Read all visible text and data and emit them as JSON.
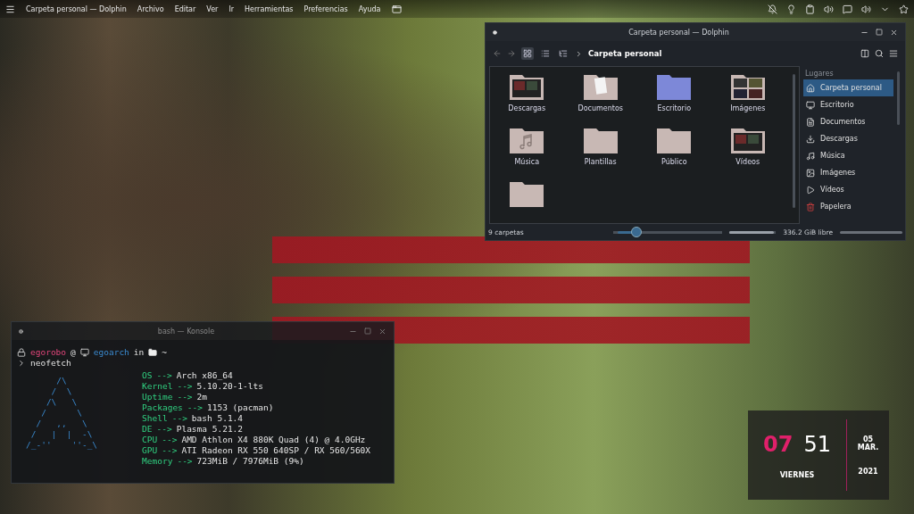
{
  "top_panel": {
    "window_title": "Carpeta personal — Dolphin",
    "menus": [
      "Archivo",
      "Editar",
      "Ver",
      "Ir",
      "Herramientas",
      "Preferencias",
      "Ayuda"
    ]
  },
  "dolphin": {
    "title": "Carpeta personal — Dolphin",
    "view_modes": [
      {
        "kind": "icons",
        "selected": true
      },
      {
        "kind": "compact",
        "selected": false
      },
      {
        "kind": "details",
        "selected": false
      }
    ],
    "breadcrumb": "Carpeta personal",
    "files": [
      {
        "name": "Descargas",
        "kind": "media"
      },
      {
        "name": "Documentos",
        "kind": "document"
      },
      {
        "name": "Escritorio",
        "kind": "desktop"
      },
      {
        "name": "Imágenes",
        "kind": "images"
      },
      {
        "name": "Música",
        "kind": "music"
      },
      {
        "name": "Plantillas",
        "kind": "plain"
      },
      {
        "name": "Público",
        "kind": "plain"
      },
      {
        "name": "Vídeos",
        "kind": "media"
      },
      {
        "kind": "plain"
      }
    ],
    "places_title": "Lugares",
    "places": [
      {
        "label": "Carpeta personal",
        "kind": "home",
        "selected": true
      },
      {
        "label": "Escritorio",
        "kind": "desktop",
        "selected": false
      },
      {
        "label": "Documentos",
        "kind": "document",
        "selected": false
      },
      {
        "label": "Descargas",
        "kind": "download",
        "selected": false
      },
      {
        "label": "Música",
        "kind": "music",
        "selected": false
      },
      {
        "label": "Imágenes",
        "kind": "image",
        "selected": false
      },
      {
        "label": "Vídeos",
        "kind": "video",
        "selected": false
      },
      {
        "label": "Papelera",
        "kind": "trash",
        "selected": false
      }
    ],
    "status": "9 carpetas",
    "zoom": {
      "level": 0.2
    },
    "free_space": {
      "text": "336.2 GiB libre",
      "level": 0.95
    }
  },
  "konsole": {
    "title": "bash — Konsole",
    "user": "egorobo",
    "at": "@",
    "host": "egoarch",
    "in": "in",
    "path": "~",
    "command": "neofetch",
    "logo_lines": [
      "      /\\",
      "     /  \\",
      "    /\\   \\",
      "   /      \\",
      "  /   ,,   \\",
      " /   |  |  -\\",
      "/_-''    ''-_\\"
    ],
    "info": [
      {
        "key": "OS",
        "arrow": "-->",
        "value": "Arch x86_64"
      },
      {
        "key": "Kernel",
        "arrow": "-->",
        "value": "5.10.20-1-lts"
      },
      {
        "key": "Uptime",
        "arrow": "-->",
        "value": "2m"
      },
      {
        "key": "Packages",
        "arrow": "-->",
        "value": "1153 (pacman)"
      },
      {
        "key": "Shell",
        "arrow": "-->",
        "value": "bash 5.1.4"
      },
      {
        "key": "DE",
        "arrow": "-->",
        "value": "Plasma 5.21.2"
      },
      {
        "key": "CPU",
        "arrow": "-->",
        "value": "AMD Athlon X4 880K Quad (4) @ 4.0GHz"
      },
      {
        "key": "GPU",
        "arrow": "-->",
        "value": "ATI Radeon RX 550 640SP / RX 560/560X"
      },
      {
        "key": "Memory",
        "arrow": "-->",
        "value": "723MiB / 7976MiB (9%)"
      }
    ]
  },
  "clock": {
    "hour": "07",
    "minute": "51",
    "day": "05",
    "month": "MAR.",
    "year": "2021",
    "weekday": "VIERNES"
  }
}
